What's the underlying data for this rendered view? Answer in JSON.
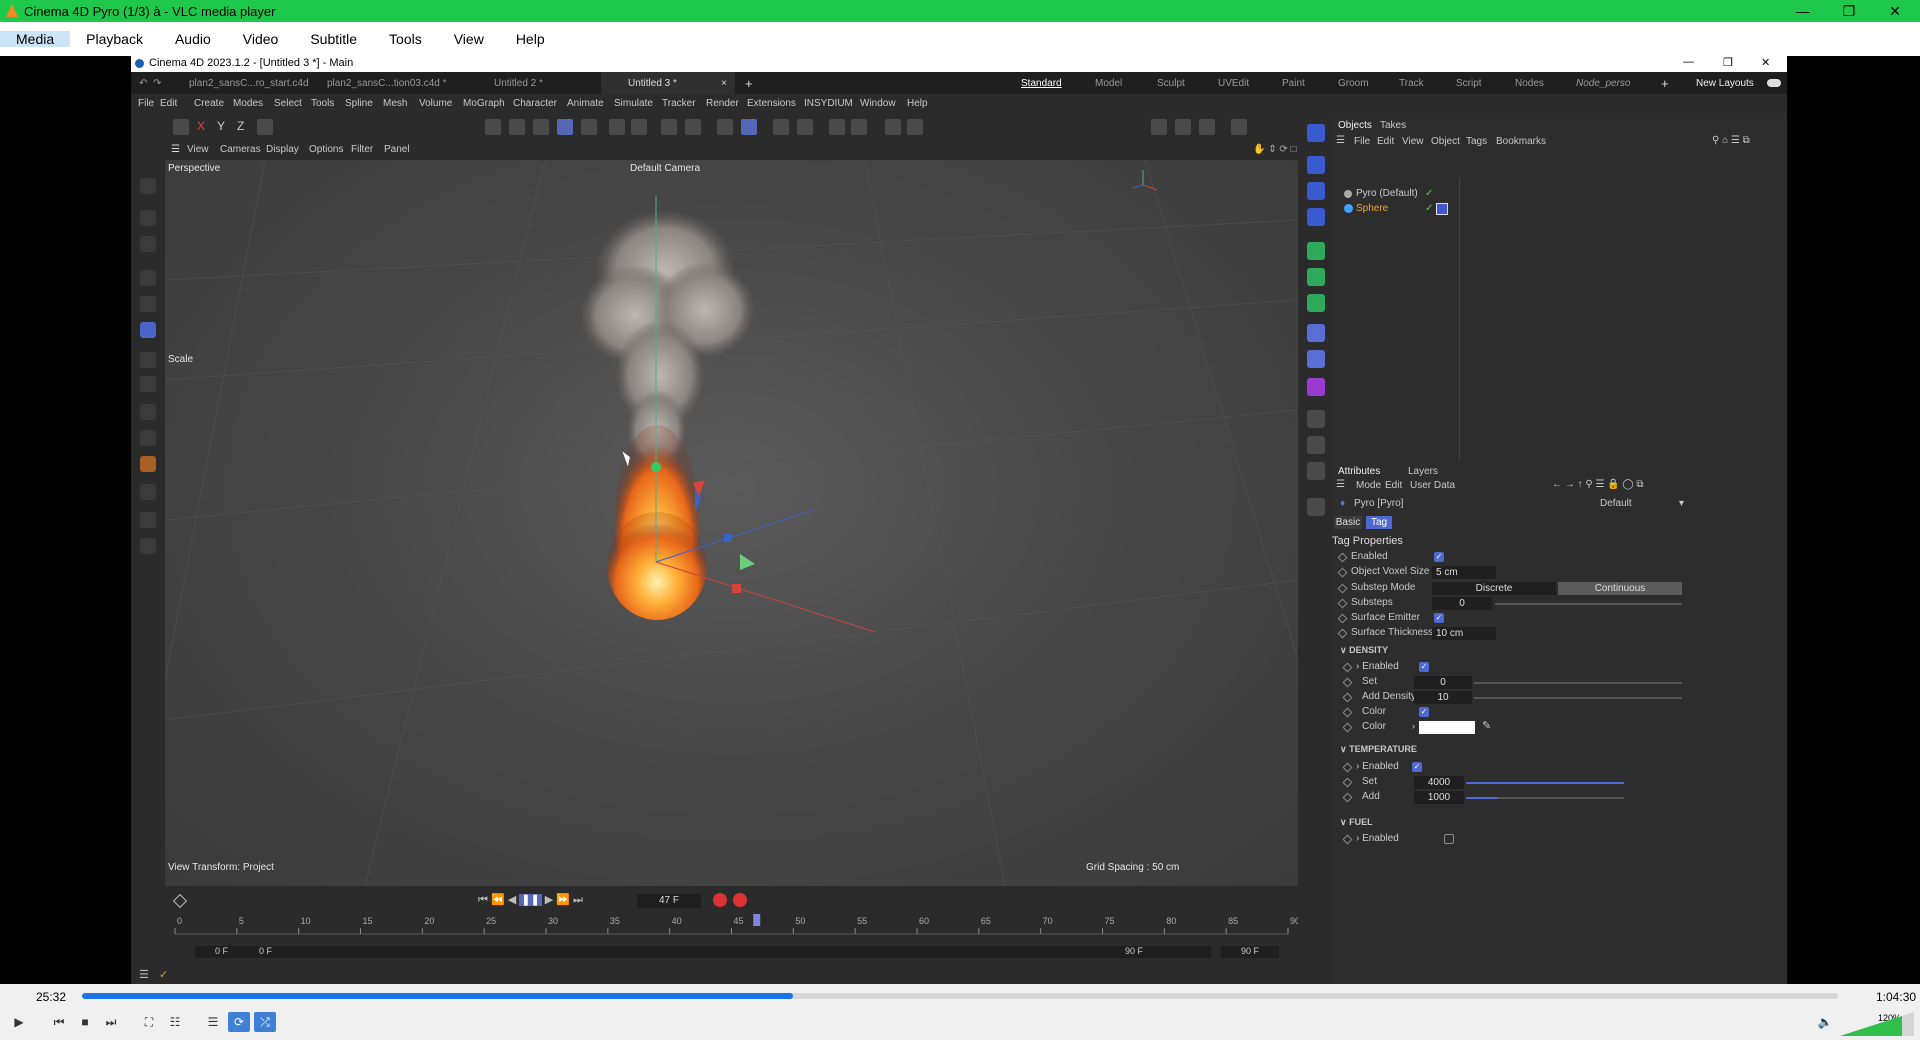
{
  "vlc": {
    "window_title": "Cinema 4D Pyro (1/3) à - VLC media player",
    "menu": [
      "Media",
      "Playback",
      "Audio",
      "Video",
      "Subtitle",
      "Tools",
      "View",
      "Help"
    ],
    "elapsed": "25:32",
    "total": "1:04:30",
    "progress": 0.405,
    "volume": "120%"
  },
  "c4d": {
    "window_title": "Cinema 4D 2023.1.2 - [Untitled 3 *] - Main",
    "doc_tabs": [
      "plan2_sansC...ro_start.c4d",
      "plan2_sansC...tion03.c4d *",
      "Untitled 2 *",
      "Untitled 3 *"
    ],
    "layouts": [
      "Standard",
      "Model",
      "Sculpt",
      "UVEdit",
      "Paint",
      "Groom",
      "Track",
      "Script",
      "Nodes",
      "Node_perso"
    ],
    "new_layouts": "New Layouts",
    "menu": [
      "File",
      "Edit",
      "Create",
      "Modes",
      "Select",
      "Tools",
      "Spline",
      "Mesh",
      "Volume",
      "MoGraph",
      "Character",
      "Animate",
      "Simulate",
      "Tracker",
      "Render",
      "Extensions",
      "INSYDIUM",
      "Window",
      "Help"
    ],
    "viewport": {
      "menu": [
        "View",
        "Cameras",
        "Display",
        "Options",
        "Filter",
        "Panel"
      ],
      "projection": "Perspective",
      "camera": "Default Camera",
      "tool": "Scale",
      "view_transform": "View Transform: Project",
      "grid_spacing": "Grid Spacing : 50 cm"
    },
    "timeline": {
      "current_frame": "47 F",
      "ticks": [
        "0",
        "5",
        "10",
        "15",
        "20",
        "25",
        "30",
        "35",
        "40",
        "45",
        "50",
        "55",
        "60",
        "65",
        "70",
        "75",
        "80",
        "85",
        "90"
      ],
      "start": "0 F",
      "preview_start": "0 F",
      "preview_end": "90 F",
      "end": "90 F",
      "playhead_frame": 47,
      "max_frame": 90
    },
    "objects": {
      "tabs": [
        "Objects",
        "Takes"
      ],
      "menu": [
        "File",
        "Edit",
        "View",
        "Object",
        "Tags",
        "Bookmarks"
      ],
      "items": [
        "Pyro (Default)",
        "Sphere"
      ]
    },
    "attributes": {
      "tabs": [
        "Attributes",
        "Layers"
      ],
      "menu": [
        "Mode",
        "Edit",
        "User Data"
      ],
      "object": "Pyro [Pyro]",
      "preset": "Default",
      "subtabs": [
        "Basic",
        "Tag"
      ],
      "section": "Tag Properties",
      "props": {
        "enabled": "Enabled",
        "voxel_label": "Object Voxel Size",
        "voxel": "5 cm",
        "substep_mode_label": "Substep Mode",
        "discrete": "Discrete",
        "continuous": "Continuous",
        "substeps_label": "Substeps",
        "substeps": "0",
        "surface_emitter": "Surface Emitter",
        "thickness_label": "Surface Thickness",
        "thickness": "10 cm"
      },
      "density": {
        "title": "DENSITY",
        "enabled": "Enabled",
        "set_label": "Set",
        "set": "0",
        "add_label": "Add Density",
        "add": "10",
        "color_label": "Color",
        "color_value": "#ffffff"
      },
      "temperature": {
        "title": "TEMPERATURE",
        "enabled": "Enabled",
        "set_label": "Set",
        "set": "4000",
        "add_label": "Add",
        "add": "1000"
      },
      "fuel": {
        "title": "FUEL",
        "enabled": "Enabled"
      }
    }
  }
}
